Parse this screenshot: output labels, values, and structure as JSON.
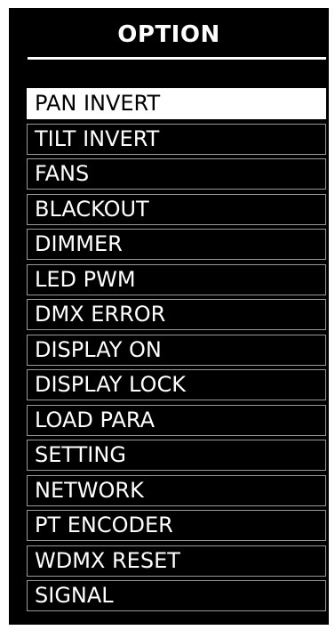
{
  "screen": {
    "title": "OPTION"
  },
  "colors": {
    "background": "#000000",
    "text": "#ffffff",
    "selected_background": "#ffffff",
    "selected_text": "#000000",
    "item_border": "#9a9a9a"
  },
  "menu": {
    "selected_index": 0,
    "items": [
      {
        "label": "PAN INVERT"
      },
      {
        "label": "TILT INVERT"
      },
      {
        "label": "FANS"
      },
      {
        "label": "BLACKOUT"
      },
      {
        "label": "DIMMER"
      },
      {
        "label": "LED PWM"
      },
      {
        "label": "DMX ERROR"
      },
      {
        "label": "DISPLAY ON"
      },
      {
        "label": "DISPLAY LOCK"
      },
      {
        "label": "LOAD PARA"
      },
      {
        "label": "SETTING"
      },
      {
        "label": "NETWORK"
      },
      {
        "label": "PT ENCODER"
      },
      {
        "label": "WDMX RESET"
      },
      {
        "label": "SIGNAL"
      }
    ]
  }
}
